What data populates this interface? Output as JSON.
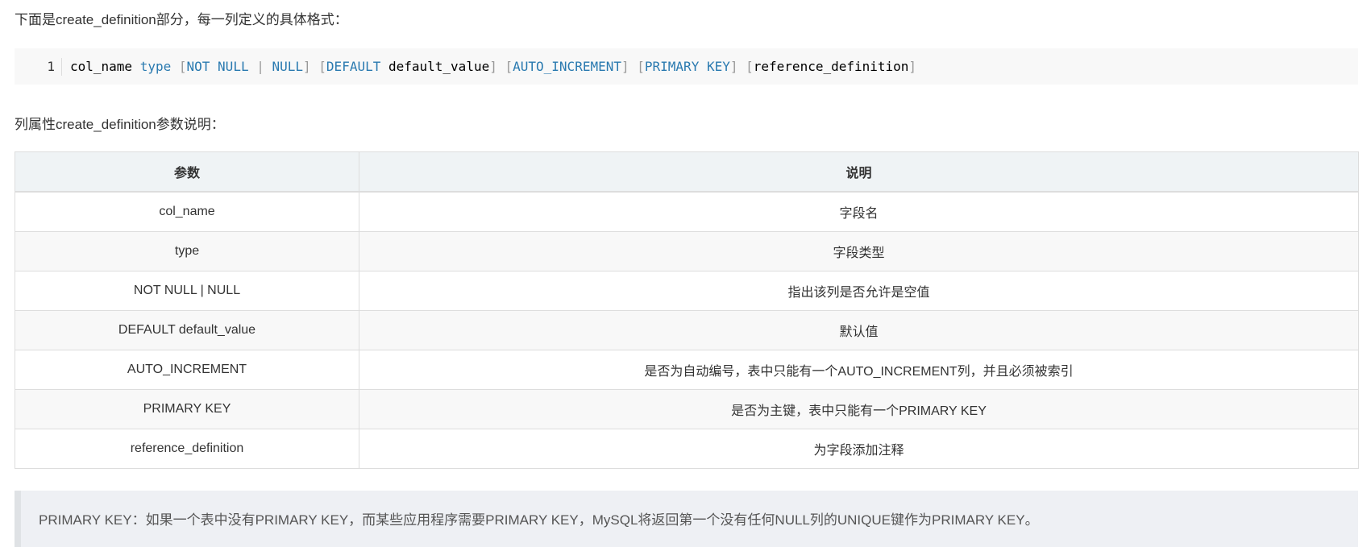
{
  "intro": "下面是create_definition部分，每一列定义的具体格式：",
  "code": {
    "line_number": "1",
    "tokens": [
      {
        "text": "col_name ",
        "cls": "t"
      },
      {
        "text": "type ",
        "cls": "k"
      },
      {
        "text": "[",
        "cls": "b"
      },
      {
        "text": "NOT NULL ",
        "cls": "k"
      },
      {
        "text": "| ",
        "cls": "b"
      },
      {
        "text": "NULL",
        "cls": "k"
      },
      {
        "text": "] [",
        "cls": "b"
      },
      {
        "text": "DEFAULT ",
        "cls": "k"
      },
      {
        "text": "default_value",
        "cls": "t"
      },
      {
        "text": "] [",
        "cls": "b"
      },
      {
        "text": "AUTO_INCREMENT",
        "cls": "k"
      },
      {
        "text": "] [",
        "cls": "b"
      },
      {
        "text": "PRIMARY KEY",
        "cls": "k"
      },
      {
        "text": "] [",
        "cls": "b"
      },
      {
        "text": "reference_definition",
        "cls": "t"
      },
      {
        "text": "]",
        "cls": "b"
      }
    ]
  },
  "label2": "列属性create_definition参数说明：",
  "table": {
    "headers": [
      "参数",
      "说明"
    ],
    "rows": [
      [
        "col_name",
        "字段名"
      ],
      [
        "type",
        "字段类型"
      ],
      [
        "NOT NULL | NULL",
        "指出该列是否允许是空值"
      ],
      [
        "DEFAULT default_value",
        "默认值"
      ],
      [
        "AUTO_INCREMENT",
        "是否为自动编号，表中只能有一个AUTO_INCREMENT列，并且必须被索引"
      ],
      [
        "PRIMARY KEY",
        "是否为主键，表中只能有一个PRIMARY KEY"
      ],
      [
        "reference_definition",
        "为字段添加注释"
      ]
    ]
  },
  "note": "PRIMARY KEY：如果一个表中没有PRIMARY KEY，而某些应用程序需要PRIMARY KEY，MySQL将返回第一个没有任何NULL列的UNIQUE键作为PRIMARY KEY。"
}
